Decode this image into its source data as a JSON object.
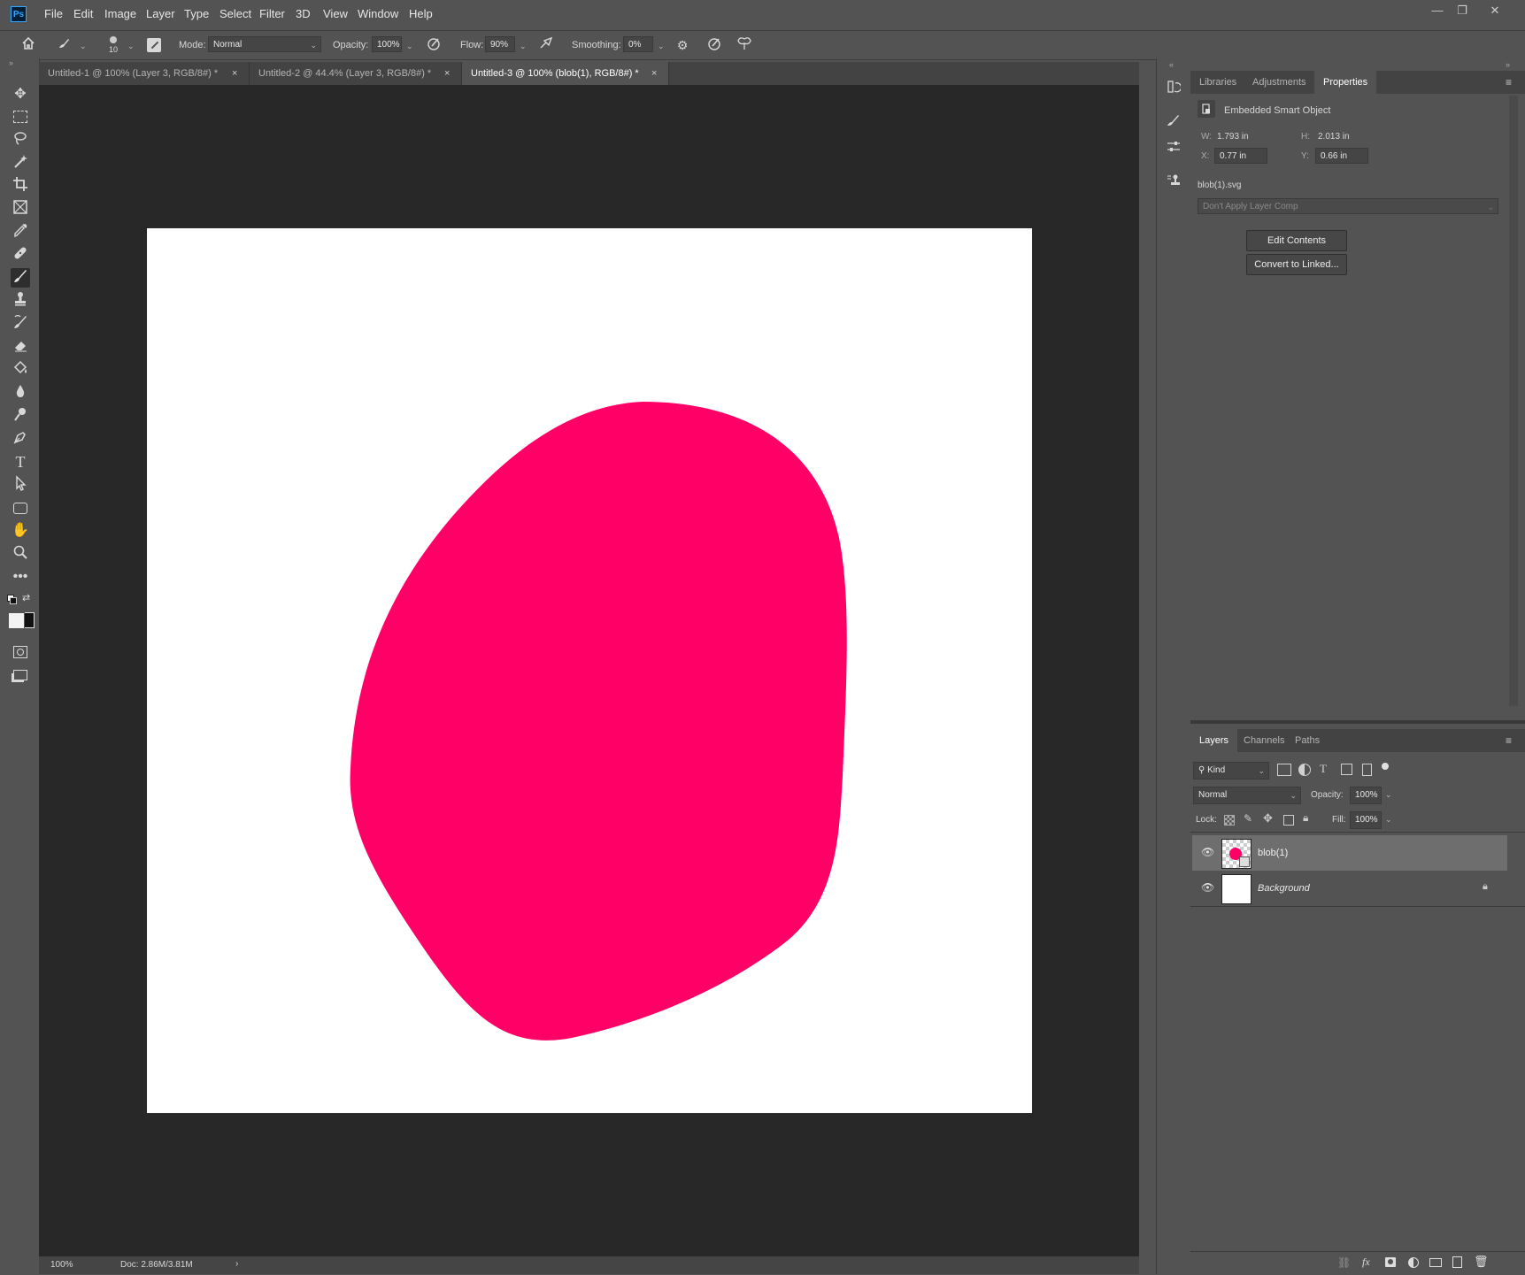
{
  "app": {
    "logo_text": "Ps",
    "menu": [
      "File",
      "Edit",
      "Image",
      "Layer",
      "Type",
      "Select",
      "Filter",
      "3D",
      "View",
      "Window",
      "Help"
    ],
    "window_controls": [
      "—",
      "❐",
      "✕"
    ]
  },
  "options_bar": {
    "brush_size": "10",
    "mode_label": "Mode:",
    "mode_value": "Normal",
    "opacity_label": "Opacity:",
    "opacity_value": "100%",
    "flow_label": "Flow:",
    "flow_value": "90%",
    "smoothing_label": "Smoothing:",
    "smoothing_value": "0%"
  },
  "tabs": [
    {
      "label": "Untitled-1 @ 100% (Layer 3, RGB/8#) *",
      "close": "×"
    },
    {
      "label": "Untitled-2 @ 44.4% (Layer 3, RGB/8#) *",
      "close": "×"
    },
    {
      "label": "Untitled-3 @ 100% (blob(1), RGB/8#) *",
      "close": "×"
    }
  ],
  "status_bar": {
    "zoom": "100%",
    "doc_info": "Doc: 2.86M/3.81M",
    "arrow": "›"
  },
  "properties_panel": {
    "tabs": [
      "Libraries",
      "Adjustments",
      "Properties"
    ],
    "object_type": "Embedded Smart Object",
    "w_label": "W:",
    "w_value": "1.793 in",
    "h_label": "H:",
    "h_value": "2.013 in",
    "x_label": "X:",
    "x_value": "0.77 in",
    "y_label": "Y:",
    "y_value": "0.66 in",
    "filename": "blob(1).svg",
    "layer_comp": "Don't Apply Layer Comp",
    "edit_contents": "Edit Contents",
    "convert_linked": "Convert to Linked..."
  },
  "layers_panel": {
    "tabs": [
      "Layers",
      "Channels",
      "Paths"
    ],
    "filter_kind": "Kind",
    "blend_mode": "Normal",
    "opacity_label": "Opacity:",
    "opacity_value": "100%",
    "lock_label": "Lock:",
    "fill_label": "Fill:",
    "fill_value": "100%",
    "layers": [
      {
        "name": "blob(1)"
      },
      {
        "name": "Background"
      }
    ]
  },
  "colors": {
    "blob": "#ff0066",
    "canvas_bg": "#282828",
    "ui_bg": "#535353"
  }
}
